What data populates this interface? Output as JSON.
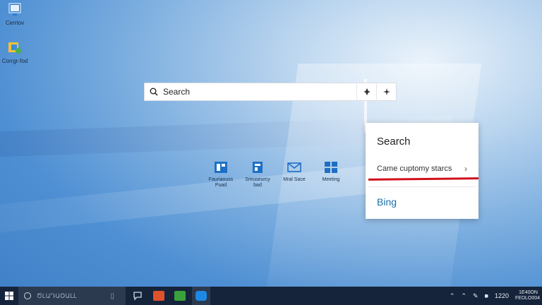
{
  "desktop": {
    "icons": [
      {
        "label": "Cerrtov",
        "icon": "folder-monitor-icon"
      },
      {
        "label": "Corrgr-fod",
        "icon": "app-shortcut-icon"
      }
    ]
  },
  "search_bar": {
    "placeholder": "Search",
    "icon": "search-icon"
  },
  "apps": [
    {
      "label": "Fauriaouss Puad",
      "icon": "app-icon",
      "color": "#1e6fc4"
    },
    {
      "label": "Sreuseurcy bad",
      "icon": "app-icon",
      "color": "#1e6fc4"
    },
    {
      "label": "Mral Sace",
      "icon": "mail-icon",
      "color": "#1e6fc4"
    },
    {
      "label": "Meeting",
      "icon": "windows-icon",
      "color": "#1e6fc4"
    }
  ],
  "flyout": {
    "title": "Search",
    "item_label": "Came cuptomy starcs",
    "footer_label": "Bing",
    "accent": "#d0101a"
  },
  "taskbar": {
    "search_text": "ԾԼԱԴԱՕԱԼԼ",
    "cursor_glyph": "▯",
    "time": "1220",
    "clock_line1": "1E40ON",
    "clock_line2": "FEDLO004",
    "pinned": [
      {
        "icon": "chat-icon",
        "color": "#1a2a40"
      },
      {
        "icon": "office-icon",
        "color": "#e0522b"
      },
      {
        "icon": "media-icon",
        "color": "#3aa23a"
      },
      {
        "icon": "browser-icon",
        "color": "#1e88e5"
      }
    ]
  }
}
